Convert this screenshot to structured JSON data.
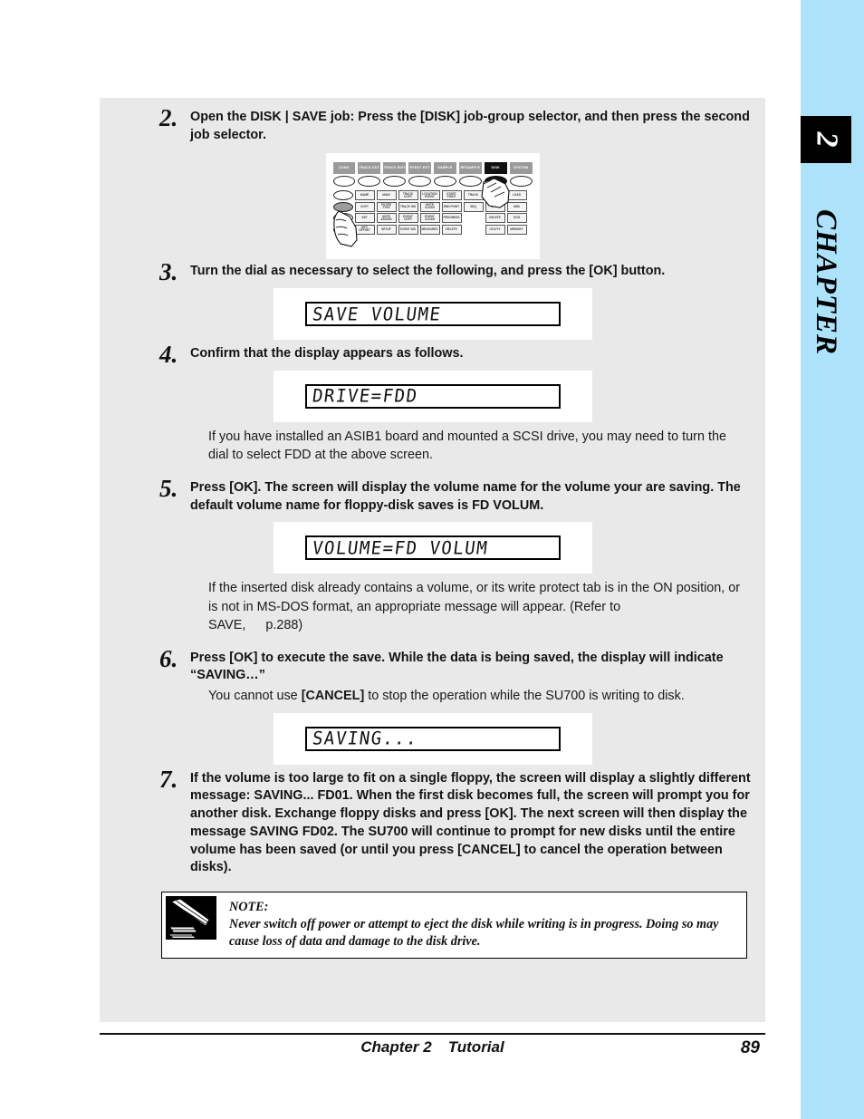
{
  "sidebar": {
    "chapter_number": "2",
    "chapter_word": "CHAPTER",
    "background_color": "#ade3fa",
    "box_color": "#000000"
  },
  "steps": [
    {
      "number": "2.",
      "text": "Open the DISK | SAVE job: Press the [DISK] job-group selector, and then press the second job selector."
    },
    {
      "number": "3.",
      "text": "Turn the dial as necessary to select the following, and press the [OK] button."
    },
    {
      "number": "4.",
      "text": "Confirm that the display appears as follows."
    },
    {
      "number": "5.",
      "text": "Press [OK]. The screen will display the volume name for the volume your are saving. The default volume name for floppy-disk saves is FD VOLUM."
    },
    {
      "number": "6.",
      "text": "Press [OK] to execute the save. While the data is being saved, the display will indicate “SAVING…”"
    },
    {
      "number": "7.",
      "text": "If the volume is too large to fit on a single floppy, the screen will display a slightly different message: SAVING... FD01. When the first disk becomes full, the screen will prompt you for another disk. Exchange floppy disks and press [OK]. The next screen will then display the message SAVING FD02. The SU700 will continue to prompt for new disks until the entire volume has been saved (or until you press [CANCEL] to cancel the operation between disks)."
    }
  ],
  "sub_paragraphs": {
    "after_step4": "If you have installed an ASIB1 board and mounted a SCSI drive, you may need to turn the dial to select FDD at the above screen.",
    "after_step5_a": "If the inserted disk already contains a volume, or its write protect tab is in the ON position, or is not in MS-DOS format, an appropriate message will appear. (Refer to",
    "after_step5_b": "SAVE,",
    "after_step5_c": "p.288)",
    "after_step6_pre": "You cannot use ",
    "after_step6_key": "[CANCEL]",
    "after_step6_post": " to stop the operation while the SU700 is writing to disk."
  },
  "lcd_displays": {
    "save_volume": "SAVE VOLUME",
    "drive_fdd": "DRIVE=FDD",
    "volume_fd_volum": "VOLUME=FD VOLUM",
    "saving": "SAVING..."
  },
  "panel_figure": {
    "top_row": [
      {
        "label": "SONG",
        "active": false
      },
      {
        "label": "TRACK EDT",
        "active": false
      },
      {
        "label": "TRACK EDIT",
        "active": false
      },
      {
        "label": "EVENT EDT",
        "active": false
      },
      {
        "label": "SAMPLE",
        "active": false
      },
      {
        "label": "RESAMPLE",
        "active": false
      },
      {
        "label": "DISK",
        "active": true
      },
      {
        "label": "SYSTEM",
        "active": false
      }
    ],
    "grid_rows": [
      [
        "NAME",
        "MAIN",
        "TRACK COPY",
        "LOCATION EVENT",
        "START POINT",
        "TRACK",
        "",
        "LOAD"
      ],
      [
        "COPY",
        "FILTER TYPE",
        "TRACK INS",
        "NOTE CLEAR",
        "END POINT",
        "SEQ",
        "SAVE",
        "MIDI"
      ],
      [
        "INIT",
        "NOTE ASSIGN",
        "EVENT COPY",
        "EVENT CLEAR",
        "PROGRESS",
        "",
        "DELETE",
        "SCSI"
      ],
      [
        "MTC OFFSET",
        "SETUP",
        "EVENT INS",
        "MEASURES",
        "DELETE",
        "",
        "UTILITY",
        "MEMORY"
      ]
    ],
    "highlighted_cell": "SAVE"
  },
  "note": {
    "heading": "NOTE:",
    "body": "Never switch off power or attempt to eject the disk while writing is in progress. Doing so may cause loss of data and damage to the disk drive.",
    "icon": "pencil-note-icon"
  },
  "footer": {
    "chapter": "Chapter 2",
    "section": "Tutorial",
    "page_number": "89"
  }
}
